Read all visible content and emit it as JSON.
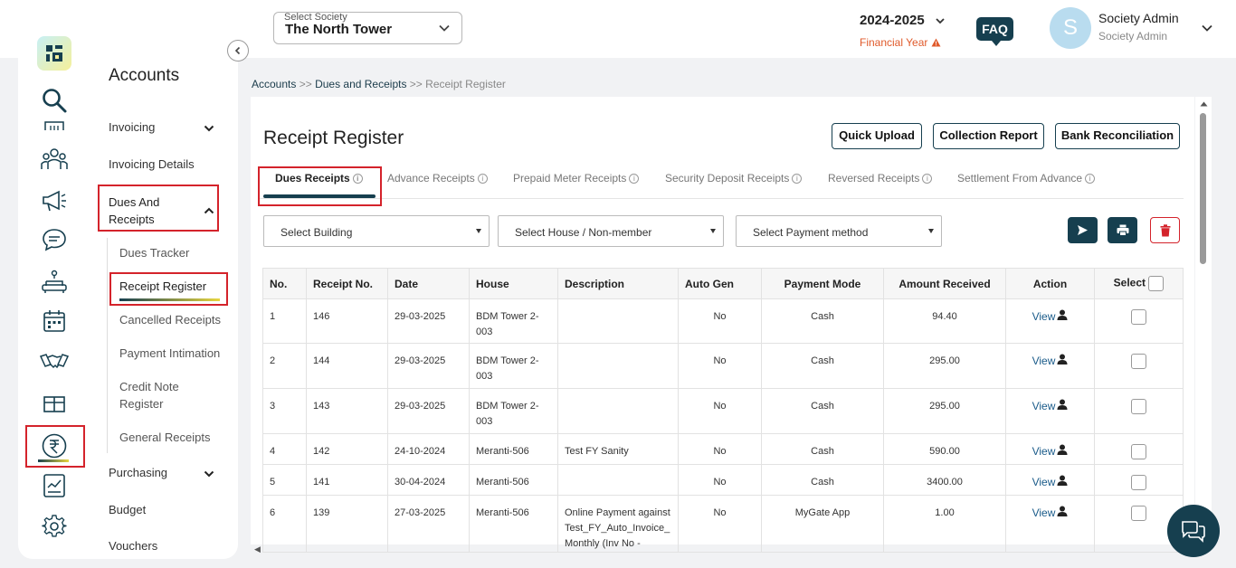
{
  "header": {
    "society_label": "Select Society",
    "society_value": "The North Tower",
    "financial_year": "2024-2025",
    "financial_year_label": "Financial Year",
    "faq": "FAQ",
    "avatar_initial": "S",
    "user_name": "Society Admin",
    "user_role": "Society Admin"
  },
  "rail_icons": [
    "search-icon",
    "building-icon",
    "people-icon",
    "megaphone-icon",
    "chat-icon",
    "sofa-icon",
    "calendar-icon",
    "handshake-icon",
    "gift-icon",
    "rupee-icon",
    "report-icon",
    "gear-icon"
  ],
  "menu": {
    "title": "Accounts",
    "invoicing": "Invoicing",
    "invoicing_details": "Invoicing Details",
    "dues_and_receipts": "Dues And Receipts",
    "sub_items": [
      "Dues Tracker",
      "Receipt Register",
      "Cancelled Receipts",
      "Payment Intimation",
      "Credit Note Register",
      "General Receipts"
    ],
    "purchasing": "Purchasing",
    "budget": "Budget",
    "vouchers": "Vouchers"
  },
  "breadcrumb": {
    "accounts": "Accounts",
    "sep1": ">>",
    "dues": "Dues and Receipts",
    "sep2": ">>",
    "current": "Receipt Register"
  },
  "page": {
    "title": "Receipt Register",
    "buttons": {
      "quick_upload": "Quick Upload",
      "collection_report": "Collection Report",
      "bank_reconciliation": "Bank Reconciliation"
    },
    "tabs": [
      "Dues Receipts",
      "Advance Receipts",
      "Prepaid Meter Receipts",
      "Security Deposit Receipts",
      "Reversed Receipts",
      "Settlement From Advance"
    ],
    "tab_info": "i",
    "filters": {
      "building": "Select Building",
      "house": "Select House / Non-member",
      "payment": "Select Payment method"
    }
  },
  "table": {
    "headers": {
      "no": "No.",
      "receipt": "Receipt No.",
      "date": "Date",
      "house": "House",
      "description": "Description",
      "autogen": "Auto Gen",
      "mode": "Payment Mode",
      "amount": "Amount Received",
      "action": "Action",
      "select": "Select"
    },
    "view_label": "View",
    "rows": [
      {
        "no": "1",
        "receipt": "146",
        "date": "29-03-2025",
        "house": "BDM Tower 2-003",
        "description": "",
        "autogen": "No",
        "mode": "Cash",
        "amount": "94.40"
      },
      {
        "no": "2",
        "receipt": "144",
        "date": "29-03-2025",
        "house": "BDM Tower 2-003",
        "description": "",
        "autogen": "No",
        "mode": "Cash",
        "amount": "295.00"
      },
      {
        "no": "3",
        "receipt": "143",
        "date": "29-03-2025",
        "house": "BDM Tower 2-003",
        "description": "",
        "autogen": "No",
        "mode": "Cash",
        "amount": "295.00"
      },
      {
        "no": "4",
        "receipt": "142",
        "date": "24-10-2024",
        "house": "Meranti-506",
        "description": "Test FY Sanity",
        "autogen": "No",
        "mode": "Cash",
        "amount": "590.00"
      },
      {
        "no": "5",
        "receipt": "141",
        "date": "30-04-2024",
        "house": "Meranti-506",
        "description": "",
        "autogen": "No",
        "mode": "Cash",
        "amount": "3400.00"
      },
      {
        "no": "6",
        "receipt": "139",
        "date": "27-03-2025",
        "house": "Meranti-506",
        "description": "Online Payment against Test_FY_Auto_Invoice_ Monthly (Inv No -",
        "autogen": "No",
        "mode": "MyGate App",
        "amount": "1.00"
      }
    ]
  },
  "colors": {
    "primary": "#163f4f",
    "highlight": "#d4232b",
    "warning": "#e05a2b",
    "link": "#1a5b8a"
  }
}
